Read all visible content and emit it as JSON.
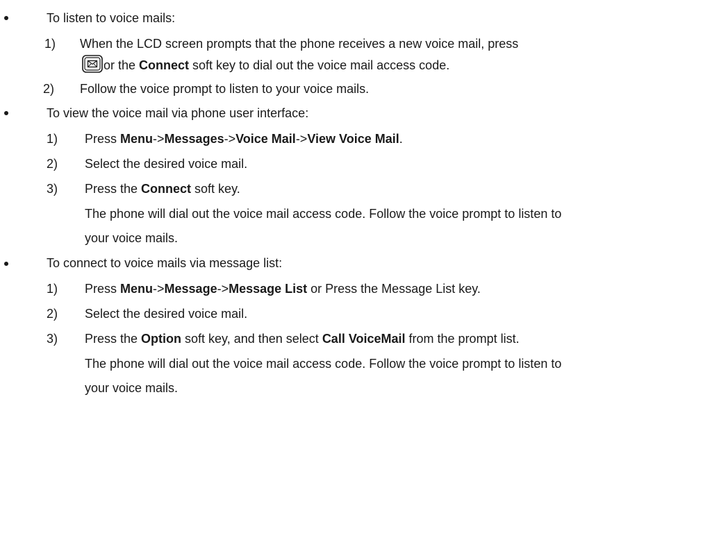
{
  "sections": [
    {
      "heading": "To listen to voice mails:",
      "steps": [
        {
          "num": "1)",
          "parts": [
            "When the LCD screen prompts that the phone receives a new voice mail, press"
          ],
          "cont_parts": [
            " or the ",
            "Connect",
            " soft key to dial out the voice mail access code."
          ],
          "cont_key_icon": "message-key-icon"
        },
        {
          "num": "2)",
          "parts": [
            "Follow the voice prompt to listen to your voice mails."
          ]
        }
      ]
    },
    {
      "heading": "To view the voice mail via phone user interface:",
      "steps": [
        {
          "num": "1)",
          "parts": [
            "Press ",
            "Menu",
            "->",
            "Messages",
            "->",
            "Voice Mail",
            "->",
            "View Voice Mail",
            "."
          ]
        },
        {
          "num": "2)",
          "parts": [
            "Select the desired voice mail."
          ]
        },
        {
          "num": "3)",
          "parts": [
            "Press the ",
            "Connect",
            " soft key."
          ],
          "note_lines": [
            "The phone will dial out the voice mail access code. Follow the voice prompt to listen to",
            "your voice mails."
          ]
        }
      ]
    },
    {
      "heading": "To connect to voice mails via message list:",
      "steps": [
        {
          "num": "1)",
          "parts": [
            "Press ",
            "Menu",
            "->",
            "Message",
            "->",
            "Message List",
            " or Press the Message List key."
          ]
        },
        {
          "num": "2)",
          "parts": [
            "Select the desired voice mail."
          ]
        },
        {
          "num": "3)",
          "parts": [
            "Press the ",
            "Option",
            " soft key, and then select ",
            "Call VoiceMail",
            " from the prompt list."
          ],
          "note_lines": [
            "The phone will dial out the voice mail access code. Follow the voice prompt to listen to",
            "your voice mails."
          ]
        }
      ]
    }
  ]
}
